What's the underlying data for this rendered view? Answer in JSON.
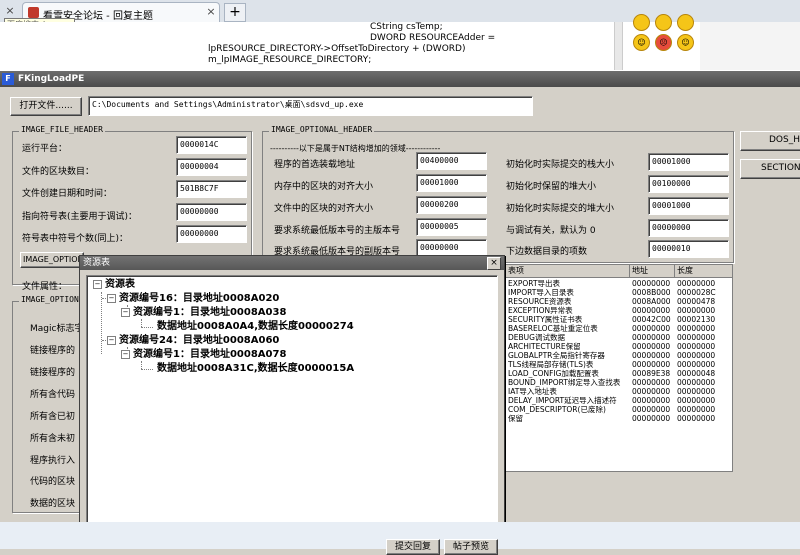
{
  "browser": {
    "tab_title": "看雪安全论坛 - 回复主题",
    "tooltip": "百度搜索_kanxue",
    "close_glyph": "×",
    "new_tab_glyph": "+"
  },
  "webpage": {
    "code_lines": [
      "CString csTemp;",
      "DWORD RESOURCEAdder =",
      "lpRESOURCE_DIRECTORY->OffsetToDirectory + (DWORD)",
      "m_lpIMAGE_RESOURCE_DIRECTORY;"
    ],
    "bottom_buttons": [
      "提交回复",
      "帖子预览"
    ]
  },
  "app": {
    "title": "FKingLoadPE",
    "open_file_label": "打开文件......",
    "file_path": "C:\\Documents and Settings\\Administrator\\桌面\\sdsvd_up.exe",
    "file_header": {
      "title": "IMAGE_FILE_HEADER",
      "fields": [
        {
          "label": "运行平台：",
          "value": "0000014C"
        },
        {
          "label": "文件的区块数目：",
          "value": "00000004"
        },
        {
          "label": "文件创建日期和时间：",
          "value": "501B8C7F"
        },
        {
          "label": "指向符号表(主要用于调试)：",
          "value": "00000000"
        },
        {
          "label": "符号表中符号个数(同上)：",
          "value": "00000000"
        }
      ],
      "partial_label": "IMAGE_OPTION",
      "attr_label": "文件属性："
    },
    "optional_header2": {
      "title": "IMAGE_OPTION",
      "labels": [
        "Magic标志字",
        "链接程序的",
        "链接程序的",
        "所有含代码",
        "所有含已初",
        "所有含未初",
        "程序执行入",
        "代码的区块",
        "数据的区块"
      ]
    },
    "optional_header": {
      "title": "IMAGE_OPTIONAL_HEADER",
      "note": "----------以下是属于NT结构增加的领域------------",
      "left_fields": [
        {
          "label": "程序的首选装载地址",
          "value": "00400000"
        },
        {
          "label": "内存中的区块的对齐大小",
          "value": "00001000"
        },
        {
          "label": "文件中的区块的对齐大小",
          "value": "00000200"
        },
        {
          "label": "要求系统最低版本号的主版本号",
          "value": "00000005"
        },
        {
          "label": "要求系统最低版本号的副版本号",
          "value": "00000000"
        }
      ],
      "right_fields": [
        {
          "label": "初始化时实际提交的栈大小",
          "value": "00001000"
        },
        {
          "label": "初始化时保留的堆大小",
          "value": "00100000"
        },
        {
          "label": "初始化时实际提交的堆大小",
          "value": "00001000"
        },
        {
          "label": "与调试有关，默认为 0",
          "value": "00000000"
        },
        {
          "label": "下边数据目录的项数",
          "value": "00000010"
        }
      ]
    },
    "side_buttons": [
      "DOS_HEA",
      "SECTION_"
    ],
    "table": {
      "columns": [
        "表项",
        "地址",
        "长度"
      ],
      "rows": [
        [
          "EXPORT导出表",
          "00000000",
          "00000000"
        ],
        [
          "IMPORT导入目录表",
          "0008B000",
          "0000028C"
        ],
        [
          "RESOURCE资源表",
          "0008A000",
          "00000478"
        ],
        [
          "EXCEPTION异常表",
          "00000000",
          "00000000"
        ],
        [
          "SECURITY属性证书表",
          "00042C00",
          "00002130"
        ],
        [
          "BASERELOC基址重定位表",
          "00000000",
          "00000000"
        ],
        [
          "DEBUG调试数据",
          "00000000",
          "00000000"
        ],
        [
          "ARCHITECTURE保留",
          "00000000",
          "00000000"
        ],
        [
          "GLOBALPTR全局指针寄存器",
          "00000000",
          "00000000"
        ],
        [
          "TLS线程局部存储(TLS)表",
          "00000000",
          "00000000"
        ],
        [
          "LOAD_CONFIG加载配置表",
          "00089E38",
          "00000048"
        ],
        [
          "BOUND_IMPORT绑定导入查找表",
          "00000000",
          "00000000"
        ],
        [
          "IAT导入地址表",
          "00000000",
          "00000000"
        ],
        [
          "DELAY_IMPORT延迟导入描述符",
          "00000000",
          "00000000"
        ],
        [
          "COM_DESCRIPTOR(已废除)",
          "00000000",
          "00000000"
        ],
        [
          "保留",
          "00000000",
          "00000000"
        ]
      ]
    }
  },
  "resource_dialog": {
    "title": "资源表",
    "close_glyph": "×",
    "tree": [
      {
        "text": "资源表",
        "box": "−"
      },
      {
        "text": "资源编号16：目录地址0008A020",
        "box": "−"
      },
      {
        "text": "资源编号1：目录地址0008A038",
        "box": "−"
      },
      {
        "text": "数据地址0008A0A4,数据长度00000274",
        "box": ""
      },
      {
        "text": "资源编号24：目录地址0008A060",
        "box": "−"
      },
      {
        "text": "资源编号1：目录地址0008A078",
        "box": "−"
      },
      {
        "text": "数据地址0008A31C,数据长度0000015A",
        "box": ""
      }
    ]
  }
}
